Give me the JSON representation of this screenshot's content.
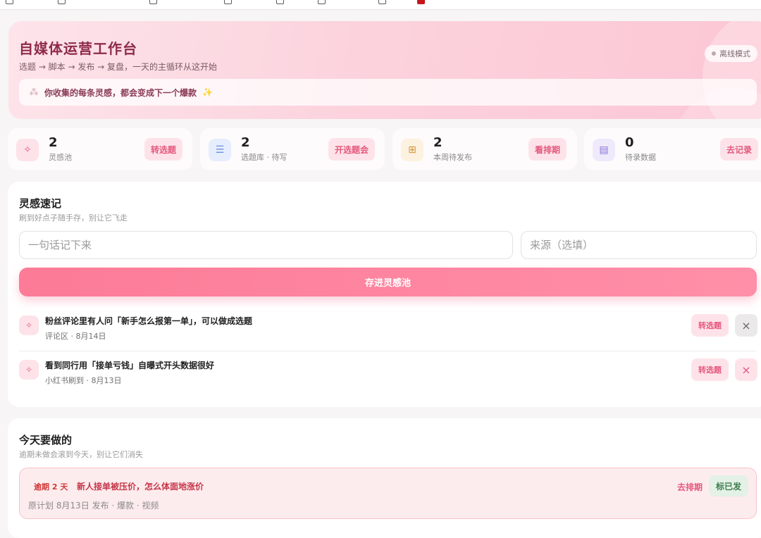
{
  "header": {
    "title": "自媒体运营工作台",
    "subtitle": "选题 → 脚本 → 发布 → 复盘，一天的主循环从这开始",
    "mode_badge": "离线模式",
    "quote": "你收集的每条灵感，都会变成下一个爆款",
    "quote_icon": "sparkle-icon"
  },
  "stats": [
    {
      "icon": "sparkle-icon",
      "icon_bg": "#fde3e9",
      "icon_color": "#e4587d",
      "value": "2",
      "label": "灵感池",
      "button": "转选题"
    },
    {
      "icon": "list-icon",
      "icon_bg": "#e6edfd",
      "icon_color": "#6d8ee0",
      "value": "2",
      "label": "选题库 · 待写",
      "button": "开选题会"
    },
    {
      "icon": "calendar-plus-icon",
      "icon_bg": "#fdf1df",
      "icon_color": "#d3943c",
      "value": "2",
      "label": "本周待发布",
      "button": "看排期"
    },
    {
      "icon": "note-icon",
      "icon_bg": "#eeeafc",
      "icon_color": "#8a72d6",
      "value": "0",
      "label": "待录数据",
      "button": "去记录"
    }
  ],
  "inspiration": {
    "title": "灵感速记",
    "subtitle": "刷到好点子随手存，别让它飞走",
    "input_placeholder": "一句话记下来",
    "source_placeholder": "来源（选填）",
    "save_label": "存进灵感池",
    "items": [
      {
        "text": "粉丝评论里有人问「新手怎么报第一单」，可以做成选题",
        "meta": "评论区 · 8月14日",
        "convert_label": "转选题",
        "close_icon": "×"
      },
      {
        "text": "看到同行用「接单亏钱」自曝式开头数据很好",
        "meta": "小红书刷到 · 8月13日",
        "convert_label": "转选题",
        "close_icon": "×"
      }
    ]
  },
  "today": {
    "title": "今天要做的",
    "subtitle": "逾期未做会滚到今天，别让它们消失",
    "task": {
      "overdue": "逾期 2 天",
      "title": "新人接单被压价，怎么体面地涨价",
      "meta": "原计划 8月13日 发布 · 爆款 · 视频",
      "schedule_label": "去排期",
      "done_label": "标已发"
    }
  },
  "colors": {
    "accent": "#fc7b97",
    "title": "#8e2a4c",
    "overdue": "#d23a3a",
    "success": "#3e7d4e"
  }
}
